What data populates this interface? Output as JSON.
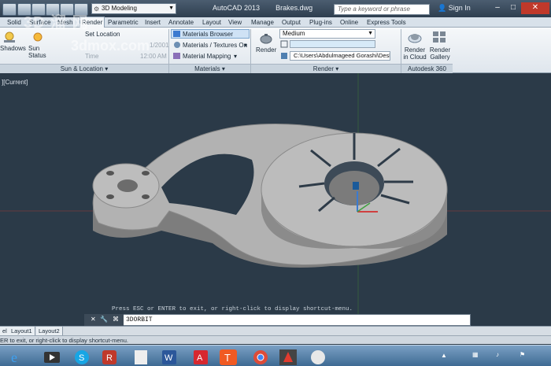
{
  "titlebar": {
    "workspace": "3D Modeling",
    "app_name": "AutoCAD 2013",
    "file_name": "Brakes.dwg",
    "search_placeholder": "Type a keyword or phrase",
    "sign_in": "Sign In"
  },
  "menu_tabs": [
    "Solid",
    "Surface",
    "Mesh",
    "Render",
    "Parametric",
    "Insert",
    "Annotate",
    "Layout",
    "View",
    "Manage",
    "Output",
    "Plug-ins",
    "Online",
    "Express Tools"
  ],
  "active_tab": "Render",
  "ribbon": {
    "sun": {
      "shadows": "Shadows",
      "sun_status": "Sun Status",
      "set_location": "Set Location",
      "date": "1/2001",
      "time": "Time",
      "time_value": "12:00 AM",
      "panel": "Sun & Location"
    },
    "materials": {
      "browser": "Materials Browser",
      "textures": "Materials / Textures On",
      "mapping": "Material Mapping",
      "panel": "Materials"
    },
    "render": {
      "button": "Render",
      "quality": "Medium",
      "path": "C:\\Users\\Abdulmageed Gorashi\\Deskt",
      "panel": "Render"
    },
    "cloud": {
      "render_in_cloud": "Render in Cloud",
      "render_gallery": "Render Gallery",
      "panel": "Autodesk 360"
    }
  },
  "viewport": {
    "label": "][Current]",
    "history": "Press ESC or ENTER to exit, or right-click to display shortcut-menu.",
    "command": "3DORBIT"
  },
  "layout_tabs": [
    "el",
    "Layout1",
    "Layout2"
  ],
  "status_text": "ER to exit, or right-click to display shortcut-menu.",
  "watermark": {
    "line1": "3D 溜 网",
    "line2": "3dmox.com"
  },
  "taskbar_apps": [
    "ie-icon",
    "media-player-icon",
    "skype-icon",
    "rhino-icon",
    "word-icon",
    "acrobat-icon",
    "t-icon",
    "chrome-icon",
    "autocad-icon",
    "paint-icon"
  ]
}
